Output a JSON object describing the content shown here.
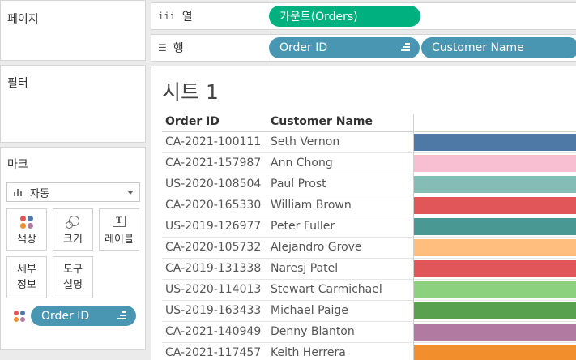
{
  "pages": {
    "title": "페이지"
  },
  "filters": {
    "title": "필터"
  },
  "marks": {
    "title": "마크",
    "type_selected": "자동",
    "buttons": [
      {
        "label": "색상",
        "icon": "color-icon"
      },
      {
        "label": "크기",
        "icon": "size-icon"
      },
      {
        "label": "레이블",
        "icon": "label-icon",
        "glyph": "T"
      },
      {
        "label": "세부\n정보",
        "icon": "detail-icon"
      },
      {
        "label": "도구\n설명",
        "icon": "tooltip-icon"
      }
    ],
    "color_field": "Order ID"
  },
  "columns_shelf": {
    "icon": "iii",
    "label": "열",
    "pills": [
      {
        "text": "카운트(Orders)"
      }
    ]
  },
  "rows_shelf": {
    "icon": "☰",
    "label": "행",
    "pills": [
      {
        "text": "Order ID"
      },
      {
        "text": "Customer Name"
      }
    ]
  },
  "sheet": {
    "title": "시트 1",
    "headers": [
      "Order ID",
      "Customer Name"
    ],
    "rows": [
      {
        "order_id": "CA-2021-100111",
        "customer": "Seth Vernon",
        "color": "#4e79a7"
      },
      {
        "order_id": "CA-2021-157987",
        "customer": "Ann Chong",
        "color": "#f8bfd3"
      },
      {
        "order_id": "US-2020-108504",
        "customer": "Paul Prost",
        "color": "#86bcb6"
      },
      {
        "order_id": "CA-2020-165330",
        "customer": "William Brown",
        "color": "#e15759"
      },
      {
        "order_id": "US-2019-126977",
        "customer": "Peter Fuller",
        "color": "#499894"
      },
      {
        "order_id": "CA-2020-105732",
        "customer": "Alejandro Grove",
        "color": "#ffbe7d"
      },
      {
        "order_id": "CA-2019-131338",
        "customer": "Naresj Patel",
        "color": "#e15759"
      },
      {
        "order_id": "US-2020-114013",
        "customer": "Stewart Carmichael",
        "color": "#8cd17d"
      },
      {
        "order_id": "US-2019-163433",
        "customer": "Michael Paige",
        "color": "#59a14f"
      },
      {
        "order_id": "CA-2021-140949",
        "customer": "Denny Blanton",
        "color": "#b07aa1"
      },
      {
        "order_id": "CA-2021-117457",
        "customer": "Keith Herrera",
        "color": "#f28e2b"
      }
    ]
  }
}
